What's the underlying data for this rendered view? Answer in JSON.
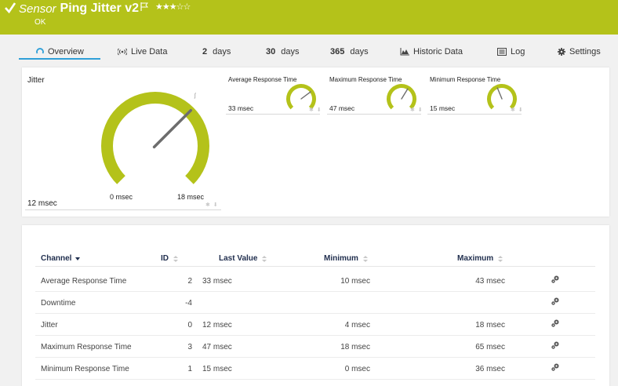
{
  "header": {
    "title_prefix": "Sensor",
    "title": "Ping Jitter v2",
    "stars": "★★★☆☆",
    "status": "OK",
    "bg_color": "#b4c21a"
  },
  "tabs": [
    {
      "label": "Overview",
      "icon": "overview-icon"
    },
    {
      "label": "Live Data",
      "icon": "live-data-icon"
    },
    {
      "num": "2",
      "label": "days"
    },
    {
      "num": "30",
      "label": "days"
    },
    {
      "num": "365",
      "label": "days"
    },
    {
      "label": "Historic Data",
      "icon": "chart-icon"
    },
    {
      "label": "Log",
      "icon": "log-icon"
    },
    {
      "label": "Settings",
      "icon": "settings-icon"
    }
  ],
  "main_gauge": {
    "title": "Jitter",
    "value_text": "12 msec",
    "min_label": "0 msec",
    "max_label": "18 msec",
    "value": 12,
    "min": 0,
    "max": 18,
    "color": "#b4c21a"
  },
  "mini_gauges": [
    {
      "title": "Average Response Time",
      "value_text": "33 msec",
      "value": 33,
      "min": 10,
      "max": 43
    },
    {
      "title": "Maximum Response Time",
      "value_text": "47 msec",
      "value": 47,
      "min": 18,
      "max": 65
    },
    {
      "title": "Minimum Response Time",
      "value_text": "15 msec",
      "value": 15,
      "min": 0,
      "max": 36
    }
  ],
  "table": {
    "headers": {
      "channel": "Channel",
      "id": "ID",
      "last_value": "Last Value",
      "minimum": "Minimum",
      "maximum": "Maximum"
    },
    "rows": [
      {
        "channel": "Average Response Time",
        "id": "2",
        "last": "33 msec",
        "min": "10 msec",
        "max": "43 msec"
      },
      {
        "channel": "Downtime",
        "id": "-4",
        "last": "",
        "min": "",
        "max": ""
      },
      {
        "channel": "Jitter",
        "id": "0",
        "last": "12 msec",
        "min": "4 msec",
        "max": "18 msec"
      },
      {
        "channel": "Maximum Response Time",
        "id": "3",
        "last": "47 msec",
        "min": "18 msec",
        "max": "65 msec"
      },
      {
        "channel": "Minimum Response Time",
        "id": "1",
        "last": "15 msec",
        "min": "0 msec",
        "max": "36 msec"
      }
    ]
  }
}
